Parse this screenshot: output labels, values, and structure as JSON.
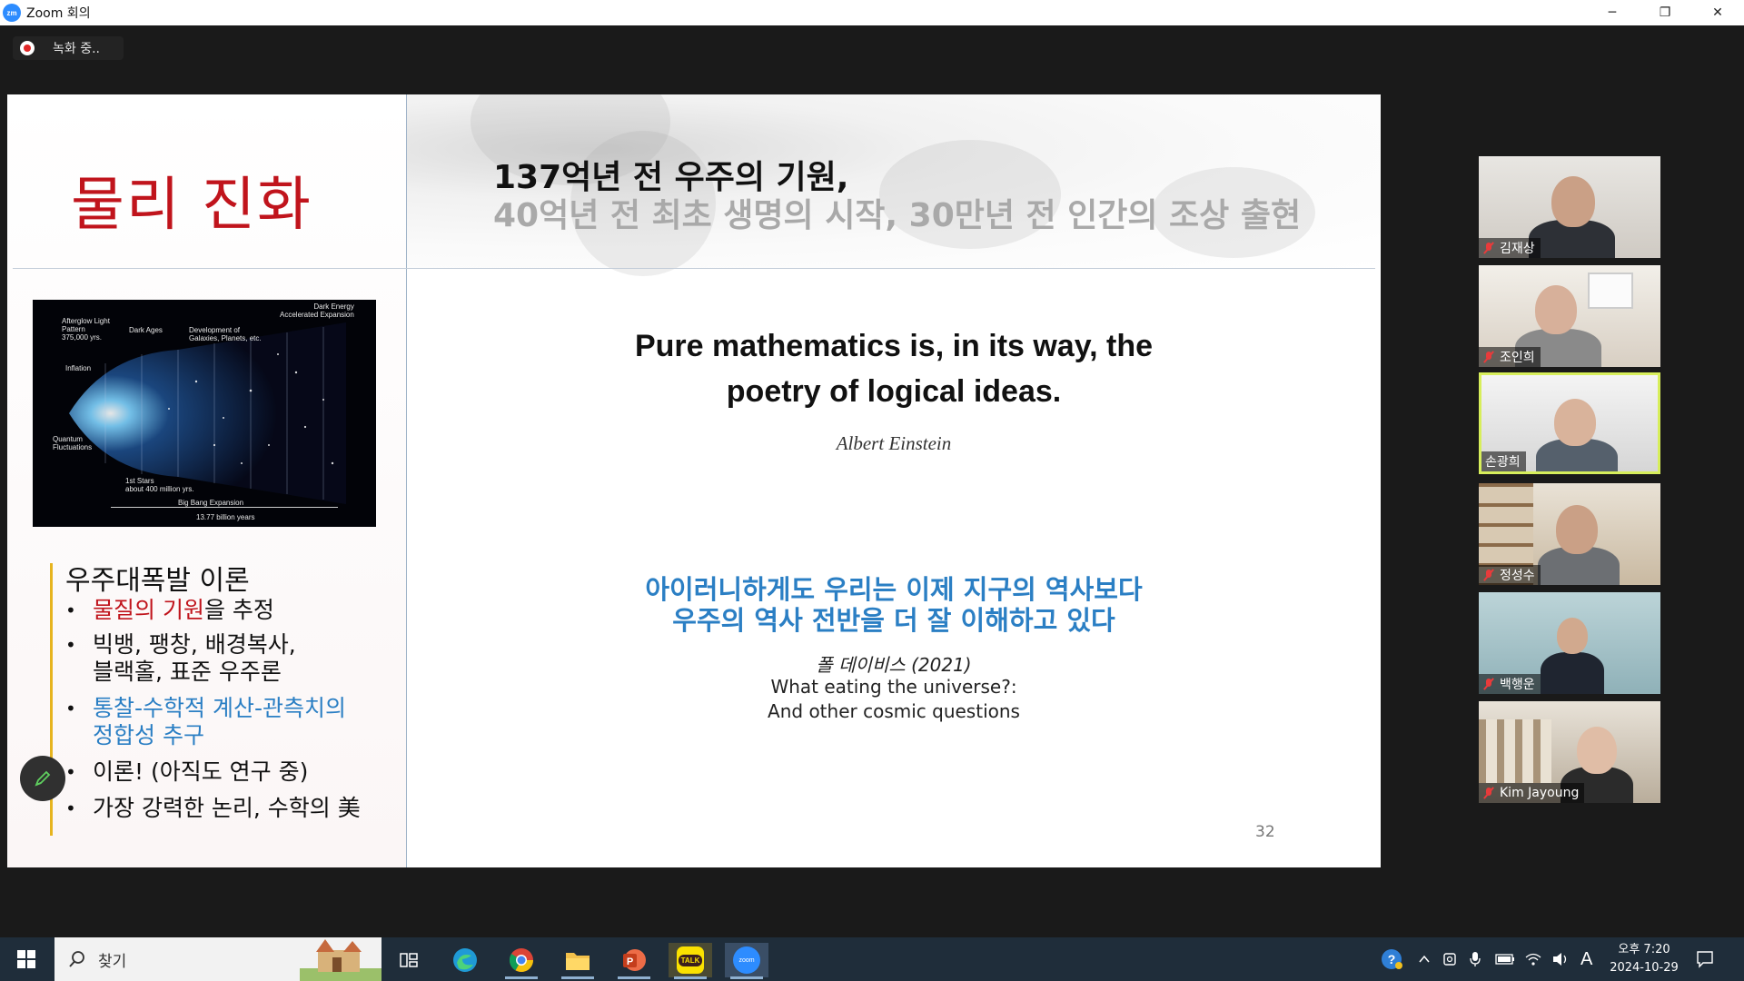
{
  "window": {
    "title": "Zoom 회의",
    "app_icon_text": "zm",
    "controls": [
      "─",
      "❐",
      "✕"
    ]
  },
  "recording": {
    "label": "녹화 중.."
  },
  "slide": {
    "title": "물리 진화",
    "header_line1": "137억년 전 우주의 기원,",
    "header_line2": "40억년 전 최초 생명의 시작, 30만년 전 인간의 조상 출현",
    "image_labels": {
      "afterglow": "Afterglow Light\nPattern\n375,000 yrs.",
      "dark_ages": "Dark Ages",
      "development": "Development of\nGalaxies, Planets, etc.",
      "dark_energy": "Dark Energy\nAccelerated Expansion",
      "inflation": "Inflation",
      "quantum": "Quantum\nFluctuations",
      "first_stars": "1st Stars\nabout 400 million yrs.",
      "big_bang": "Big Bang Expansion",
      "years": "13.77 billion years"
    },
    "theory_title": "우주대폭발 이론",
    "bullets": {
      "b1_red": "물질의 기원",
      "b1_rest": "을 추정",
      "b2_line1": "빅뱅, 팽창, 배경복사,",
      "b2_line2": "블랙홀, 표준 우주론",
      "b3_line1": "통찰-수학적 계산-관측치의",
      "b3_line2": "정합성 추구",
      "b4": "이론! (아직도 연구 중)",
      "b5": "가장 강력한 논리, 수학의 美"
    },
    "quote_line1": "Pure mathematics is, in its way, the",
    "quote_line2": "poetry of logical ideas.",
    "quote_author": "Albert Einstein",
    "korean_line1": "아이러니하게도 우리는 이제 지구의 역사보다",
    "korean_line2": "우주의 역사 전반을 더 잘 이해하고 있다",
    "cite_author": "폴 데이비스 (2021)",
    "cite_book1": "What eating the universe?:",
    "cite_book2": "And other cosmic questions",
    "page_number": "32"
  },
  "participants": [
    {
      "name": "김재상",
      "muted": true,
      "active": false
    },
    {
      "name": "조인희",
      "muted": true,
      "active": false
    },
    {
      "name": "손광희",
      "muted": false,
      "active": true
    },
    {
      "name": "정성수",
      "muted": true,
      "active": false
    },
    {
      "name": "백행운",
      "muted": true,
      "active": false
    },
    {
      "name": "Kim Jayoung",
      "muted": true,
      "active": false
    }
  ],
  "taskbar": {
    "search_label": "찾기",
    "clock_time": "오후 7:20",
    "clock_date": "2024-10-29",
    "ime": "A",
    "kakao_label": "TALK",
    "zoom_label": "zoom"
  },
  "colors": {
    "slide_title_red": "#c0141c",
    "accent_blue": "#2b7fc4",
    "active_speaker": "#d7ee5b",
    "taskbar": "#1f2d3a"
  }
}
